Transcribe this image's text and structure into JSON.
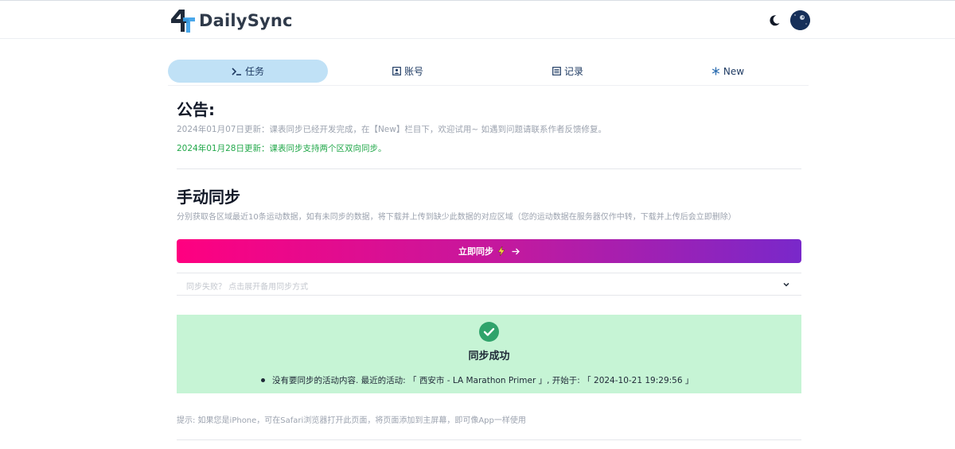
{
  "header": {
    "brand_name": "DailySync",
    "theme_icon": "moon-icon",
    "avatar_icon": "avatar"
  },
  "tabs": [
    {
      "label": "任务",
      "icon": "terminal-icon",
      "active": true
    },
    {
      "label": "账号",
      "icon": "account-icon",
      "active": false
    },
    {
      "label": "记录",
      "icon": "list-icon",
      "active": false
    },
    {
      "label": "New",
      "icon": "snowflake-icon",
      "active": false
    }
  ],
  "announcement": {
    "title": "公告:",
    "lines": [
      "2024年01月07日更新：课表同步已经开发完成，在【New】栏目下，欢迎试用~ 如遇到问题请联系作者反馈修复。",
      "2024年01月28日更新：课表同步支持两个区双向同步。"
    ]
  },
  "manual_sync": {
    "title": "手动同步",
    "description": "分别获取各区域最近10条运动数据，如有未同步的数据，将下载并上传到缺少此数据的对应区域（您的运动数据在服务器仅作中转，下载并上传后会立即删除）",
    "button_label": "立即同步",
    "fallback_label": "同步失败？ 点击展开备用同步方式"
  },
  "result": {
    "title": "同步成功",
    "message": "没有要同步的活动内容. 最近的活动: 「 西安市 - LA Marathon Primer 」, 开始于: 「 2024-10-21 19:29:56 」"
  },
  "tip": "提示: 如果您是iPhone，可在Safari浏览器打开此页面，将页面添加到主屏幕，即可像App一样使用",
  "colors": {
    "accent_tab": "#c0e1f6",
    "button_gradient_start": "#ff0080",
    "button_gradient_end": "#7928ca",
    "success_bg": "#c6f4d5",
    "success_icon": "#2fa36b",
    "update_green": "#22a84a"
  }
}
